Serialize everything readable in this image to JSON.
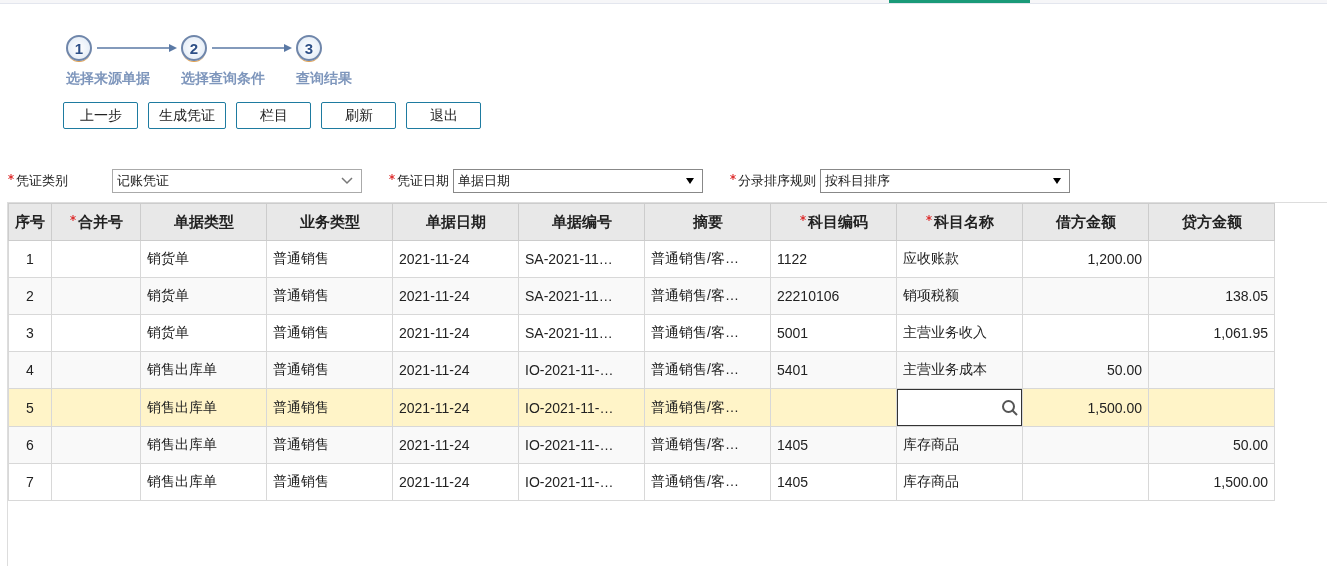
{
  "steps": [
    {
      "number": "1",
      "label": "选择来源单据"
    },
    {
      "number": "2",
      "label": "选择查询条件"
    },
    {
      "number": "3",
      "label": "查询结果"
    }
  ],
  "buttons": [
    "上一步",
    "生成凭证",
    "栏目",
    "刷新",
    "退出"
  ],
  "filters": [
    {
      "label": "凭证类别",
      "required": true,
      "value": "记账凭证",
      "kind": "select"
    },
    {
      "label": "凭证日期",
      "required": true,
      "value": "单据日期",
      "kind": "combo"
    },
    {
      "label": "分录排序规则",
      "required": true,
      "value": "按科目排序",
      "kind": "combo"
    }
  ],
  "table": {
    "columns": [
      {
        "label": "序号",
        "required": false
      },
      {
        "label": "合并号",
        "required": true
      },
      {
        "label": "单据类型",
        "required": false
      },
      {
        "label": "业务类型",
        "required": false
      },
      {
        "label": "单据日期",
        "required": false
      },
      {
        "label": "单据编号",
        "required": false
      },
      {
        "label": "摘要",
        "required": false
      },
      {
        "label": "科目编码",
        "required": true
      },
      {
        "label": "科目名称",
        "required": true
      },
      {
        "label": "借方金额",
        "required": false
      },
      {
        "label": "贷方金额",
        "required": false
      }
    ],
    "rows": [
      {
        "selected": false,
        "editing": false,
        "cells": [
          "1",
          "",
          "销货单",
          "普通销售",
          "2021-11-24",
          "SA-2021-11…",
          "普通销售/客…",
          "1122",
          "应收账款",
          "1,200.00",
          ""
        ]
      },
      {
        "selected": false,
        "editing": false,
        "cells": [
          "2",
          "",
          "销货单",
          "普通销售",
          "2021-11-24",
          "SA-2021-11…",
          "普通销售/客…",
          "22210106",
          "销项税额",
          "",
          "138.05"
        ]
      },
      {
        "selected": false,
        "editing": false,
        "cells": [
          "3",
          "",
          "销货单",
          "普通销售",
          "2021-11-24",
          "SA-2021-11…",
          "普通销售/客…",
          "5001",
          "主营业务收入",
          "",
          "1,061.95"
        ]
      },
      {
        "selected": false,
        "editing": false,
        "cells": [
          "4",
          "",
          "销售出库单",
          "普通销售",
          "2021-11-24",
          "IO-2021-11-…",
          "普通销售/客…",
          "5401",
          "主营业务成本",
          "50.00",
          ""
        ]
      },
      {
        "selected": true,
        "editing": true,
        "cells": [
          "5",
          "",
          "销售出库单",
          "普通销售",
          "2021-11-24",
          "IO-2021-11-…",
          "普通销售/客…",
          "",
          "",
          "1,500.00",
          ""
        ]
      },
      {
        "selected": false,
        "editing": false,
        "cells": [
          "6",
          "",
          "销售出库单",
          "普通销售",
          "2021-11-24",
          "IO-2021-11-…",
          "普通销售/客…",
          "1405",
          "库存商品",
          "",
          "50.00"
        ]
      },
      {
        "selected": false,
        "editing": false,
        "cells": [
          "7",
          "",
          "销售出库单",
          "普通销售",
          "2021-11-24",
          "IO-2021-11-…",
          "普通销售/客…",
          "1405",
          "库存商品",
          "",
          "1,500.00"
        ]
      }
    ]
  }
}
